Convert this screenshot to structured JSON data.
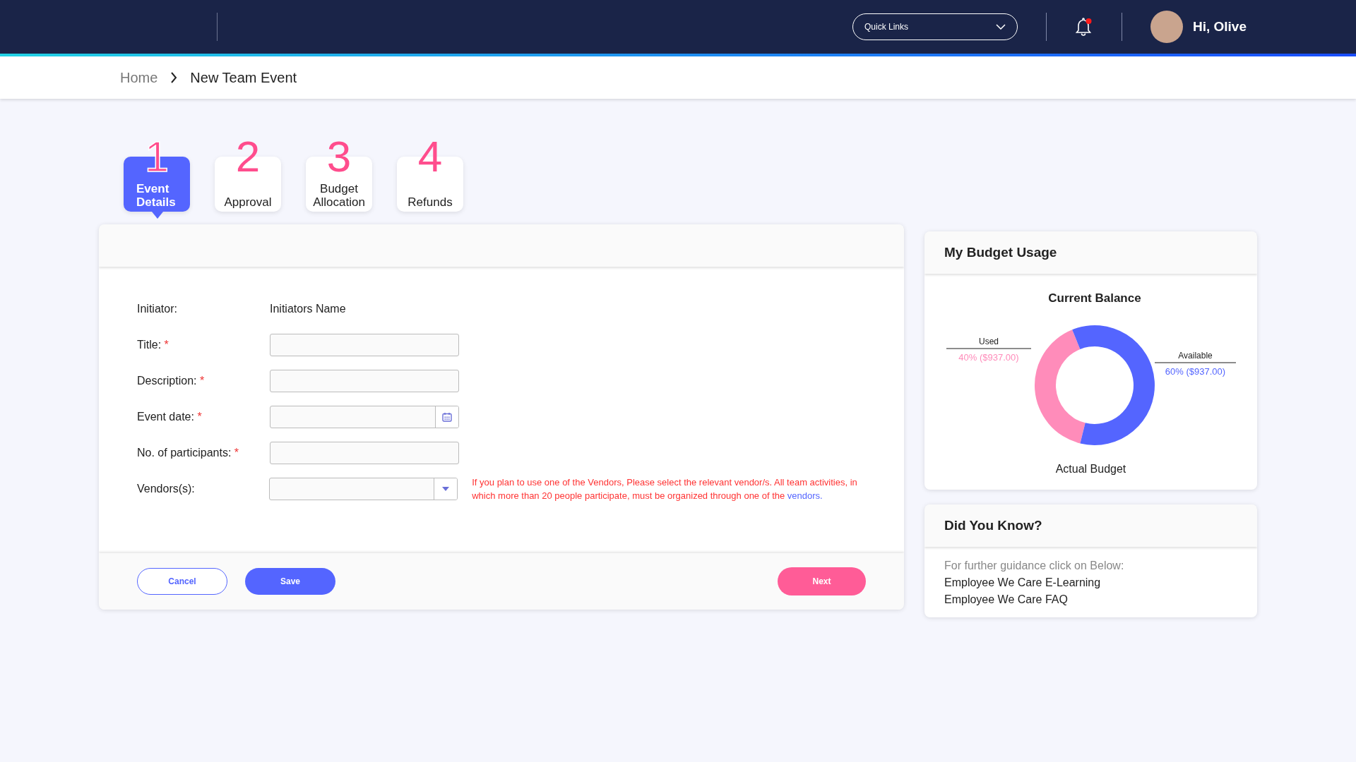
{
  "header": {
    "quick_links": {
      "label": "Quick Links"
    },
    "notifications": {
      "unread": true
    },
    "user": {
      "greeting": "Hi, Olive"
    }
  },
  "breadcrumb": [
    {
      "label": "Home",
      "current": false
    },
    {
      "label": "New Team Event",
      "current": true
    }
  ],
  "steps": [
    {
      "number": "1",
      "label": "Event Details",
      "selected": true
    },
    {
      "number": "2",
      "label": "Approval",
      "selected": false
    },
    {
      "number": "3",
      "label": "Budget Allocation",
      "selected": false
    },
    {
      "number": "4",
      "label": "Refunds",
      "selected": false
    }
  ],
  "form": {
    "fields": [
      {
        "kind": "text",
        "label": "Initiator:",
        "value": "Initiators Name"
      },
      {
        "kind": "input",
        "label": "Title:",
        "required_mark": "*"
      },
      {
        "kind": "input",
        "label": "Description:",
        "required_mark": "*"
      },
      {
        "kind": "date",
        "label": "Event date:",
        "required_mark": "*"
      },
      {
        "kind": "input",
        "label": "No. of participants:",
        "required_mark": "*"
      },
      {
        "kind": "select",
        "label": "Vendors(s):",
        "note": {
          "text": "If you plan to use one of the Vendors, Please select the relevant vendor/s. All team activities, in which more than 20 people participate, must be organized through one of the",
          "link": "vendors."
        }
      }
    ],
    "buttons": [
      {
        "kind": "outline",
        "label": "Cancel"
      },
      {
        "kind": "primary",
        "label": "Save"
      },
      {
        "kind": "accent",
        "label": "Next"
      }
    ]
  },
  "budget": {
    "title": "My Budget Usage",
    "chart_data": {
      "type": "donut",
      "title": "Current Balance",
      "categories": [
        "Used",
        "Available"
      ],
      "values": [
        40,
        60
      ],
      "colors": [
        "#ff8cba",
        "#5465ff"
      ],
      "value_labels": [
        "40% ($937.00)",
        "60% ($937.00)"
      ]
    },
    "caption": "Actual Budget"
  },
  "did_you_know": {
    "title": "Did You Know?",
    "intro": "For further guidance click on Below:",
    "links": [
      "Employee We Care E-Learning",
      "Employee We Care FAQ"
    ]
  }
}
